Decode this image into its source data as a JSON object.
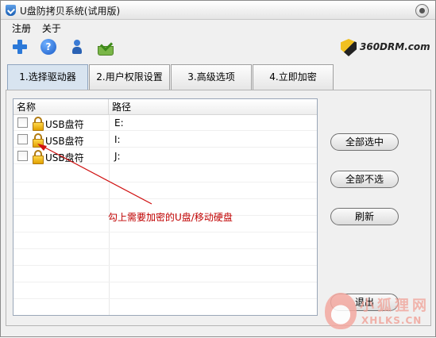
{
  "window": {
    "title": "U盘防拷贝系统(试用版)"
  },
  "menu": {
    "items": [
      "注册",
      "关于"
    ]
  },
  "toolbar": {
    "icons": [
      "plus-icon",
      "help-icon",
      "user-icon",
      "basket-icon"
    ],
    "help_glyph": "?"
  },
  "logo": {
    "text": "360DRM.com"
  },
  "tabs": [
    "1.选择驱动器",
    "2.用户权限设置",
    "3.高级选项",
    "4.立即加密"
  ],
  "list": {
    "columns": [
      "名称",
      "路径"
    ],
    "rows": [
      {
        "name": "USB盘符",
        "path": "E:"
      },
      {
        "name": "USB盘符",
        "path": "I:"
      },
      {
        "name": "USB盘符",
        "path": "J:"
      }
    ]
  },
  "buttons": {
    "select_all": "全部选中",
    "select_none": "全部不选",
    "refresh": "刷新",
    "exit": "退出"
  },
  "annotation": {
    "text": "勾上需要加密的U盘/移动硬盘",
    "color": "#c00000"
  },
  "watermark": {
    "line1": "小狐狸网",
    "line2": "XHLKS.CN"
  }
}
